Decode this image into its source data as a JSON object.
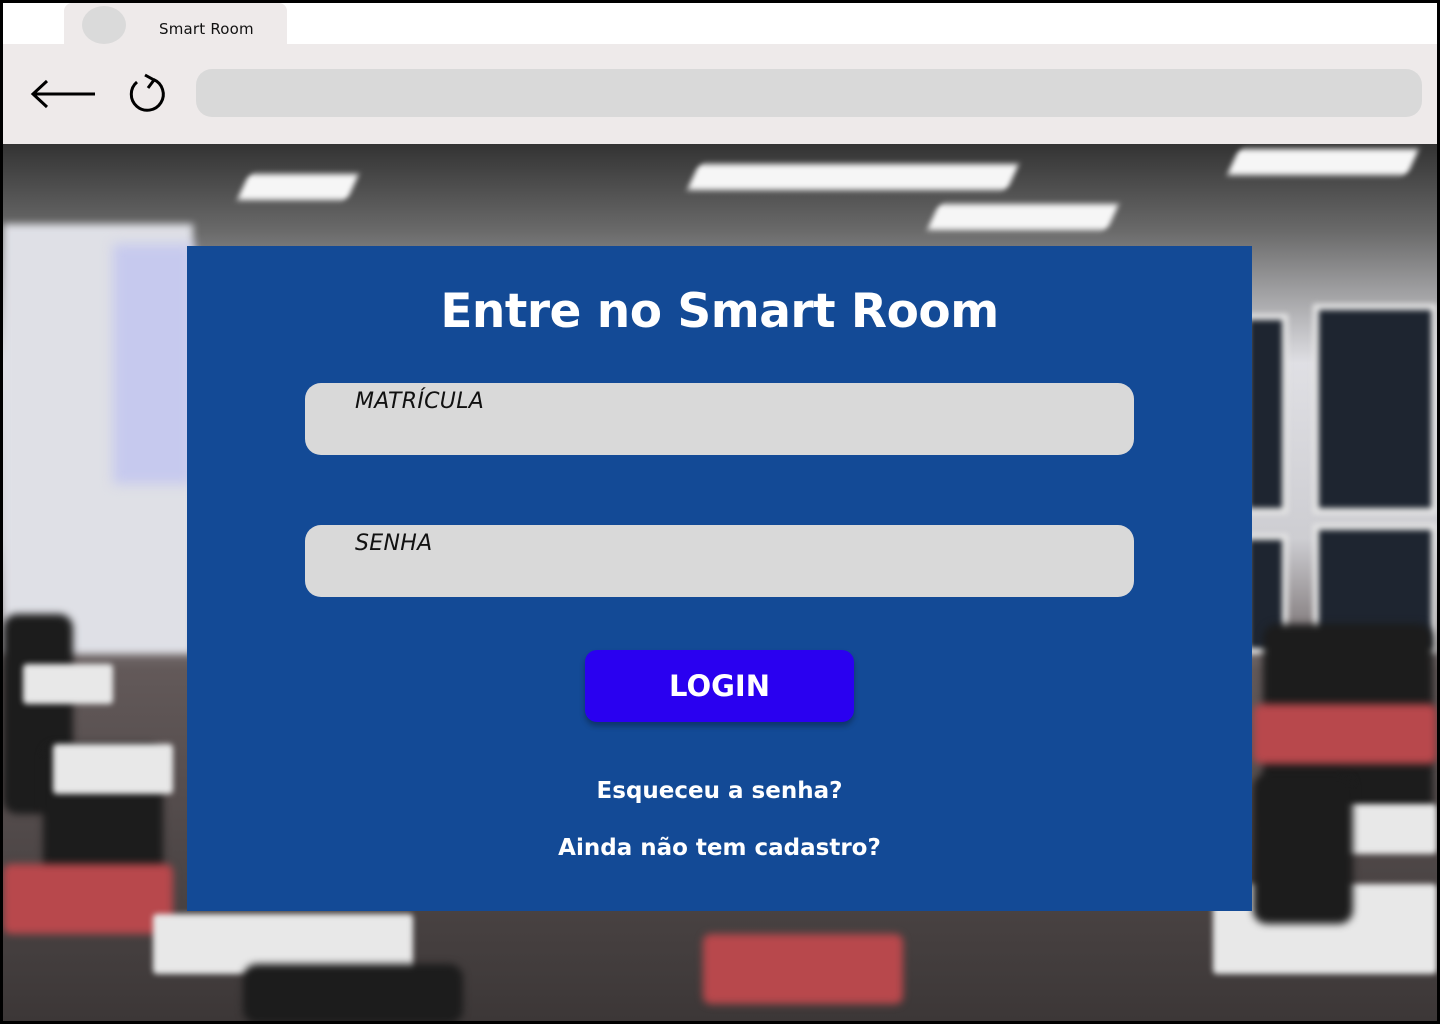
{
  "browser": {
    "tab": {
      "title": "Smart Room"
    },
    "toolbar": {
      "back_icon": "arrow-left-icon",
      "reload_icon": "reload-icon",
      "address_value": ""
    }
  },
  "login": {
    "title": "Entre no Smart Room",
    "fields": {
      "matricula": {
        "placeholder": "MATRÍCULA",
        "value": ""
      },
      "senha": {
        "placeholder": "SENHA",
        "value": ""
      }
    },
    "submit_label": "LOGIN",
    "forgot_link": "Esqueceu a senha?",
    "signup_link": "Ainda não tem cadastro?"
  },
  "colors": {
    "card": "#134a96",
    "button": "#2a00f0",
    "field": "#d9d9d9",
    "toolbar": "#eeeaea"
  }
}
